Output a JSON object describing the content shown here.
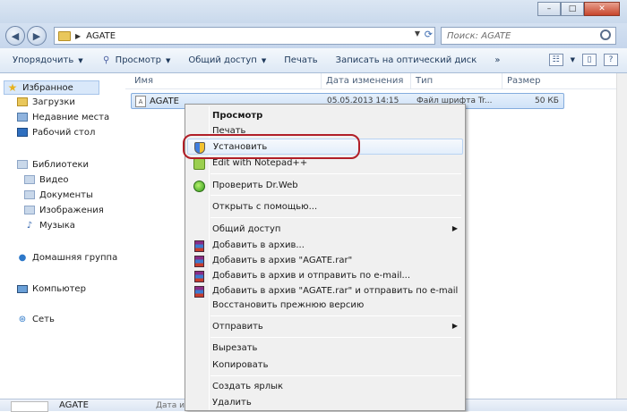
{
  "window": {
    "min": "–",
    "max": "□",
    "close": "✕"
  },
  "address": {
    "path": "AGATE",
    "search_placeholder": "Поиск: AGATE"
  },
  "toolbar": {
    "organize": "Упорядочить",
    "preview": "Просмотр",
    "share": "Общий доступ",
    "print": "Печать",
    "burn": "Записать на оптический диск",
    "more": "»"
  },
  "sidebar": {
    "favorites": "Избранное",
    "downloads": "Загрузки",
    "recent": "Недавние места",
    "desktop": "Рабочий стол",
    "libraries": "Библиотеки",
    "video": "Видео",
    "documents": "Документы",
    "images": "Изображения",
    "music": "Музыка",
    "homegroup": "Домашняя группа",
    "computer": "Компьютер",
    "network": "Сеть"
  },
  "columns": {
    "name": "Имя",
    "date": "Дата изменения",
    "type": "Тип",
    "size": "Размер"
  },
  "file": {
    "name": "AGATE",
    "date": "05.05.2013 14:15",
    "type": "Файл шрифта Tr...",
    "size": "50 КБ"
  },
  "context_menu": {
    "preview": "Просмотр",
    "print": "Печать",
    "install": "Установить",
    "notepad": "Edit with Notepad++",
    "drweb": "Проверить Dr.Web",
    "open_with": "Открыть с помощью...",
    "share": "Общий доступ",
    "add_archive": "Добавить в архив...",
    "add_rar": "Добавить в архив \"AGATE.rar\"",
    "add_email": "Добавить в архив и отправить по e-mail...",
    "add_rar_email": "Добавить в архив \"AGATE.rar\" и отправить по e-mail",
    "restore": "Восстановить прежнюю версию",
    "send_to": "Отправить",
    "cut": "Вырезать",
    "copy": "Копировать",
    "shortcut": "Создать ярлык",
    "delete": "Удалить"
  },
  "details": {
    "name": "AGATE",
    "label": "Дата из"
  },
  "colors": {
    "highlight": "#b11f28",
    "selection": "#cfe2f8"
  }
}
